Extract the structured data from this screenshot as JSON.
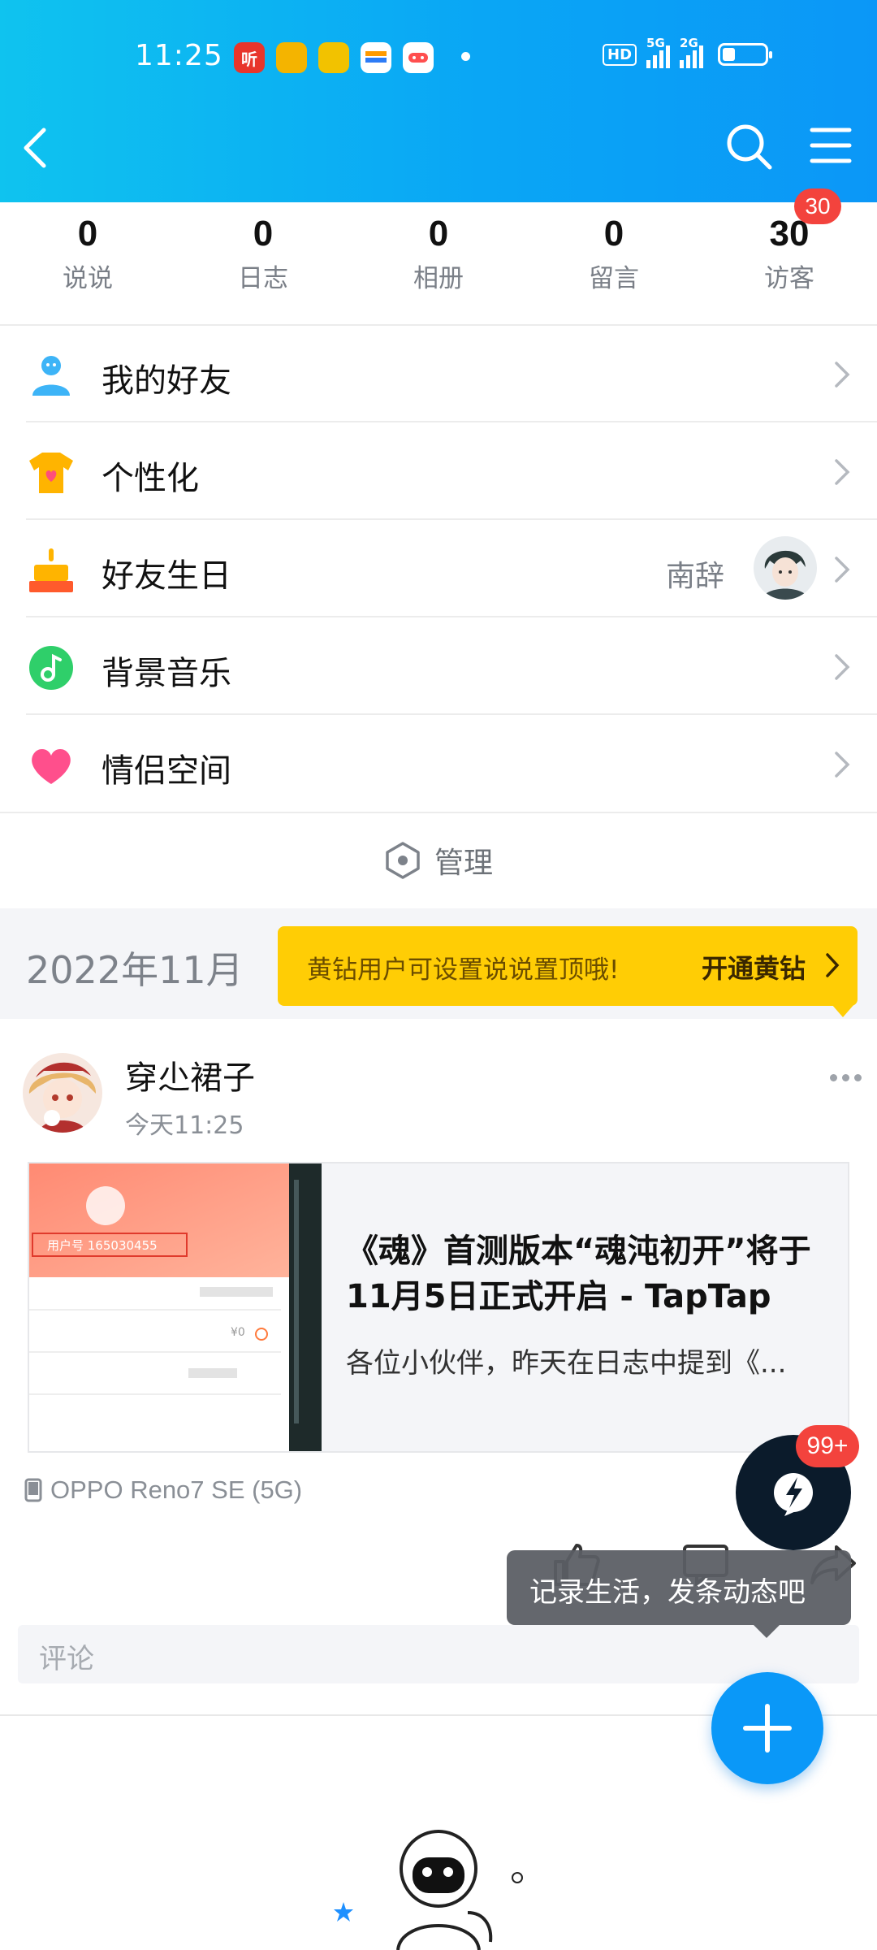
{
  "status_bar": {
    "time": "11:25",
    "apps": [
      {
        "name": "ting-app",
        "glyph": "听",
        "color": "#e8352b"
      },
      {
        "name": "app-2",
        "glyph": "",
        "color": "#f4b400"
      },
      {
        "name": "app-3",
        "glyph": "",
        "color": "#f2c200"
      },
      {
        "name": "app-4",
        "glyph": "",
        "color": "#ff9a00"
      },
      {
        "name": "game-app",
        "glyph": "",
        "color": "#ffffff"
      }
    ],
    "hd_label": "HD",
    "net1": "5G",
    "net2": "2G",
    "battery_level": 0.3
  },
  "header": {
    "back_icon": "back-arrow-icon",
    "search_icon": "search-icon",
    "menu_icon": "hamburger-menu-icon"
  },
  "stats": [
    {
      "value": "0",
      "label": "说说"
    },
    {
      "value": "0",
      "label": "日志"
    },
    {
      "value": "0",
      "label": "相册"
    },
    {
      "value": "0",
      "label": "留言"
    },
    {
      "value": "30",
      "label": "访客"
    }
  ],
  "visitor_badge": "30",
  "menu": [
    {
      "label": "我的好友",
      "icon": "friends-icon"
    },
    {
      "label": "个性化",
      "icon": "personalize-shirt-icon"
    },
    {
      "label": "好友生日",
      "icon": "birthday-cake-icon",
      "extra": "南辞"
    },
    {
      "label": "背景音乐",
      "icon": "music-note-icon"
    },
    {
      "label": "情侣空间",
      "icon": "heart-icon"
    }
  ],
  "manage": {
    "label": "管理",
    "icon": "hexagon-settings-icon"
  },
  "timeline": {
    "month": "2022年11月",
    "vip_text": "黄钻用户可设置说说置顶哦!",
    "vip_cta": "开通黄钻"
  },
  "post": {
    "user": "穿尐裙子",
    "time": "今天11:25",
    "card_title": "《魂》首测版本“魂沌初开”将于11月5日正式开启 - TapTap",
    "card_desc": "各位小伙伴，昨天在日志中提到《...",
    "thumb_user_id": "用户号 165030455",
    "thumb_balance": "¥0",
    "device": "OPPO Reno7 SE (5G)",
    "comment_placeholder": "评论"
  },
  "floating": {
    "message_badge": "99+",
    "tooltip": "记录生活，发条动态吧"
  },
  "colors": {
    "header_start": "#0fc3ef",
    "header_end": "#0b97f7",
    "accent_blue": "#0a98f8",
    "badge_red": "#f3433d",
    "vip_yellow": "#ffcd05"
  }
}
